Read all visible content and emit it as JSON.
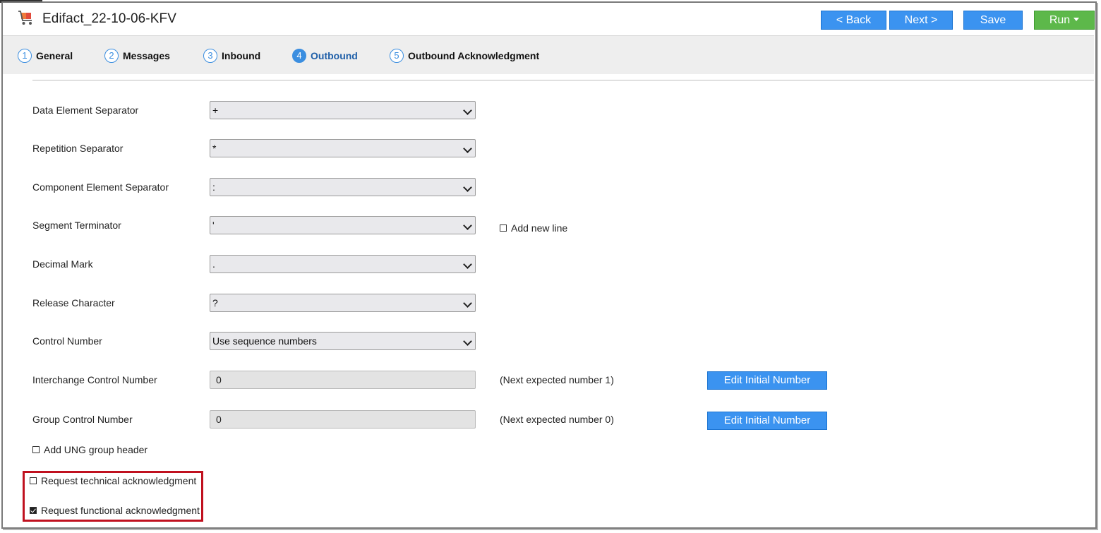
{
  "header": {
    "title": "Edifact_22-10-06-KFV",
    "buttons": {
      "back": "< Back",
      "next": "Next >",
      "save": "Save",
      "run": "Run"
    }
  },
  "steps": [
    {
      "num": "1",
      "label": "General",
      "active": false
    },
    {
      "num": "2",
      "label": "Messages",
      "active": false
    },
    {
      "num": "3",
      "label": "Inbound",
      "active": false
    },
    {
      "num": "4",
      "label": "Outbound",
      "active": true
    },
    {
      "num": "5",
      "label": "Outbound Acknowledgment",
      "active": false
    }
  ],
  "form": {
    "data_element_separator": {
      "label": "Data Element Separator",
      "value": "+"
    },
    "repetition_separator": {
      "label": "Repetition Separator",
      "value": "*"
    },
    "component_element_separator": {
      "label": "Component Element Separator",
      "value": ":"
    },
    "segment_terminator": {
      "label": "Segment Terminator",
      "value": "'"
    },
    "add_new_line": {
      "label": "Add new line",
      "checked": false
    },
    "decimal_mark": {
      "label": "Decimal Mark",
      "value": "."
    },
    "release_character": {
      "label": "Release Character",
      "value": "?"
    },
    "control_number": {
      "label": "Control Number",
      "value": "Use sequence numbers"
    },
    "interchange_control_number": {
      "label": "Interchange Control Number",
      "value": "0",
      "note": "(Next expected number 1)",
      "button": "Edit Initial Number"
    },
    "group_control_number": {
      "label": "Group Control Number",
      "value": "0",
      "note": "(Next expected number 0)",
      "button": "Edit Initial Number"
    },
    "add_ung_group_header": {
      "label": "Add UNG group header",
      "checked": false
    },
    "request_technical_ack": {
      "label": "Request technical acknowledgment",
      "checked": false
    },
    "request_functional_ack": {
      "label": "Request functional acknowledgment",
      "checked": true
    }
  },
  "colors": {
    "primary_button": "#3b93f0",
    "run_button": "#5db84a",
    "highlight_border": "#c0111f",
    "active_step": "#3b8ee0"
  }
}
